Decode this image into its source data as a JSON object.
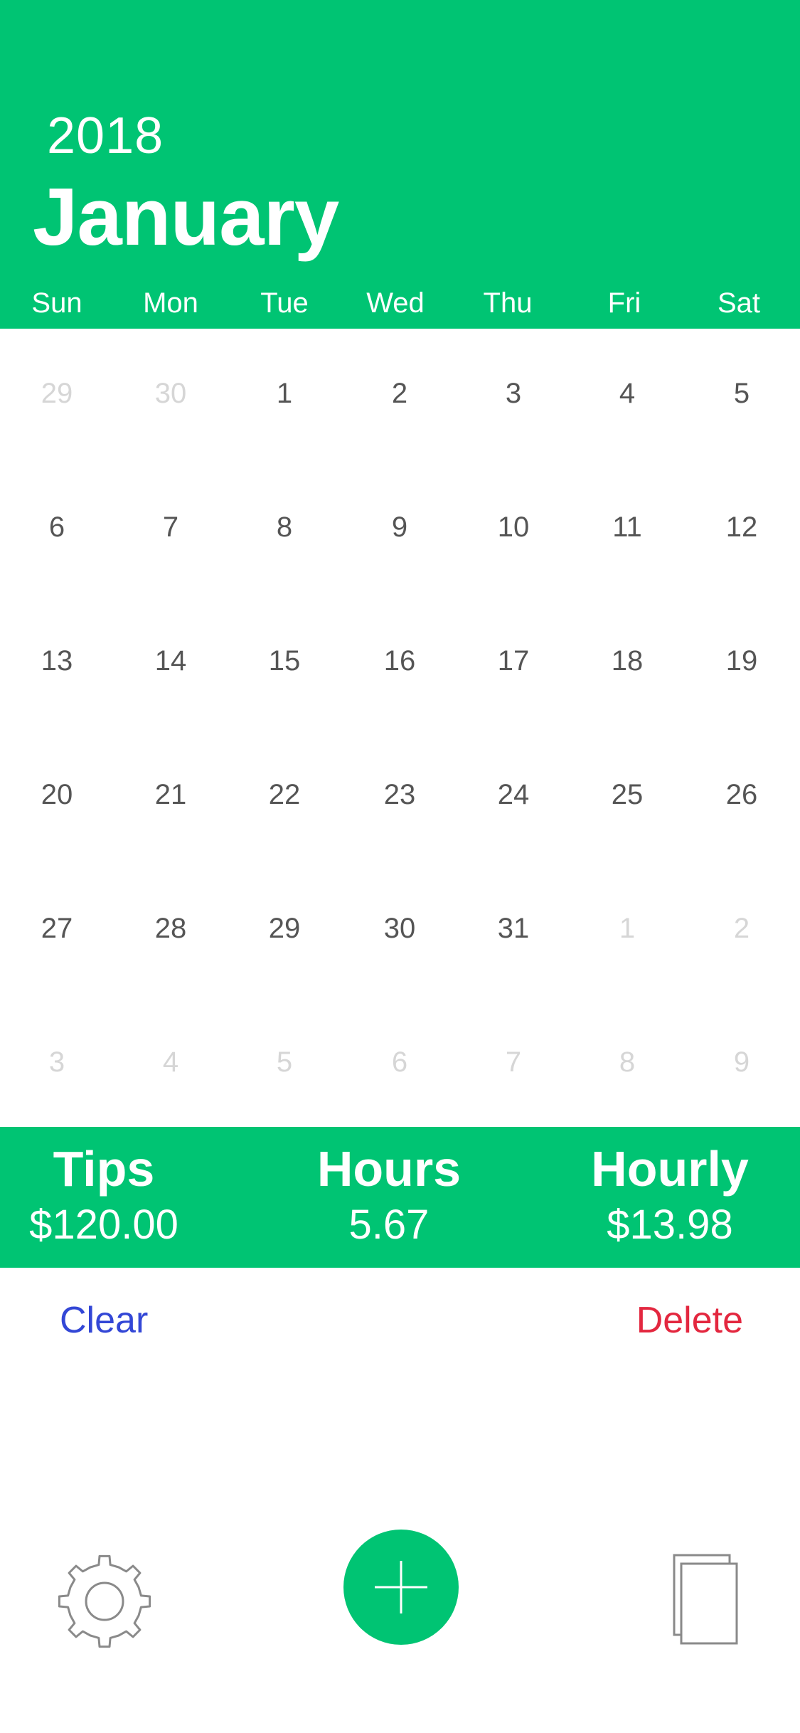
{
  "header": {
    "year": "2018",
    "month": "January",
    "weekdays": [
      "Sun",
      "Mon",
      "Tue",
      "Wed",
      "Thu",
      "Fri",
      "Sat"
    ]
  },
  "calendar": {
    "weeks": [
      [
        {
          "d": "29",
          "muted": true
        },
        {
          "d": "30",
          "muted": true
        },
        {
          "d": "1",
          "muted": false
        },
        {
          "d": "2",
          "muted": false
        },
        {
          "d": "3",
          "muted": false
        },
        {
          "d": "4",
          "muted": false
        },
        {
          "d": "5",
          "muted": false
        }
      ],
      [
        {
          "d": "6",
          "muted": false
        },
        {
          "d": "7",
          "muted": false
        },
        {
          "d": "8",
          "muted": false
        },
        {
          "d": "9",
          "muted": false
        },
        {
          "d": "10",
          "muted": false
        },
        {
          "d": "11",
          "muted": false
        },
        {
          "d": "12",
          "muted": false
        }
      ],
      [
        {
          "d": "13",
          "muted": false
        },
        {
          "d": "14",
          "muted": false
        },
        {
          "d": "15",
          "muted": false
        },
        {
          "d": "16",
          "muted": false
        },
        {
          "d": "17",
          "muted": false
        },
        {
          "d": "18",
          "muted": false
        },
        {
          "d": "19",
          "muted": false
        }
      ],
      [
        {
          "d": "20",
          "muted": false
        },
        {
          "d": "21",
          "muted": false
        },
        {
          "d": "22",
          "muted": false
        },
        {
          "d": "23",
          "muted": false
        },
        {
          "d": "24",
          "muted": false
        },
        {
          "d": "25",
          "muted": false
        },
        {
          "d": "26",
          "muted": false
        }
      ],
      [
        {
          "d": "27",
          "muted": false
        },
        {
          "d": "28",
          "muted": false
        },
        {
          "d": "29",
          "muted": false
        },
        {
          "d": "30",
          "muted": false
        },
        {
          "d": "31",
          "muted": false
        },
        {
          "d": "1",
          "muted": true
        },
        {
          "d": "2",
          "muted": true
        }
      ],
      [
        {
          "d": "3",
          "muted": true
        },
        {
          "d": "4",
          "muted": true
        },
        {
          "d": "5",
          "muted": true
        },
        {
          "d": "6",
          "muted": true
        },
        {
          "d": "7",
          "muted": true
        },
        {
          "d": "8",
          "muted": true
        },
        {
          "d": "9",
          "muted": true
        }
      ]
    ]
  },
  "summary": {
    "tips_label": "Tips",
    "tips_value": "$120.00",
    "hours_label": "Hours",
    "hours_value": "5.67",
    "hourly_label": "Hourly",
    "hourly_value": "$13.98"
  },
  "actions": {
    "clear_label": "Clear",
    "delete_label": "Delete"
  },
  "toolbar": {
    "settings_icon": "gear-icon",
    "add_icon": "plus-icon",
    "copy_icon": "copy-icon"
  },
  "colors": {
    "accent": "#00c473",
    "clear": "#3347d6",
    "delete": "#e3273f",
    "day_text": "#555555",
    "muted_day_text": "#d6d6d6"
  }
}
